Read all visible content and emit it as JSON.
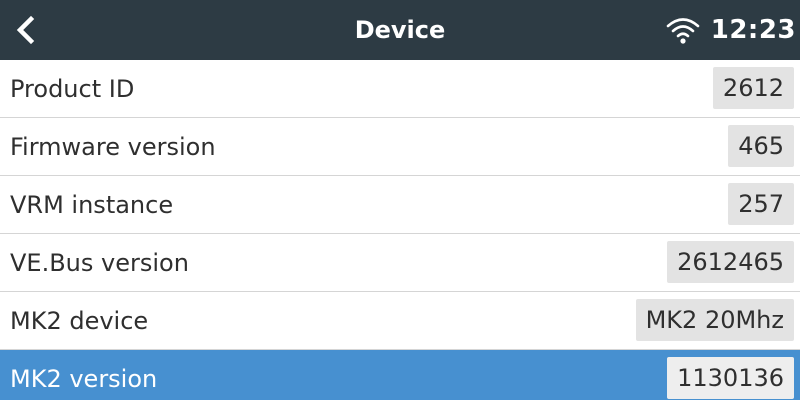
{
  "header": {
    "title": "Device",
    "time": "12:23",
    "back_icon": "chevron-left-icon",
    "wifi_icon": "wifi-icon"
  },
  "colors": {
    "header_bg": "#2d3b44",
    "selected_bg": "#4790d0",
    "value_bg": "#e3e3e3"
  },
  "rows": [
    {
      "label": "Product ID",
      "value": "2612"
    },
    {
      "label": "Firmware version",
      "value": "465"
    },
    {
      "label": "VRM instance",
      "value": "257"
    },
    {
      "label": "VE.Bus version",
      "value": "2612465"
    },
    {
      "label": "MK2 device",
      "value": "MK2 20Mhz"
    },
    {
      "label": "MK2 version",
      "value": "1130136",
      "selected": true
    }
  ]
}
